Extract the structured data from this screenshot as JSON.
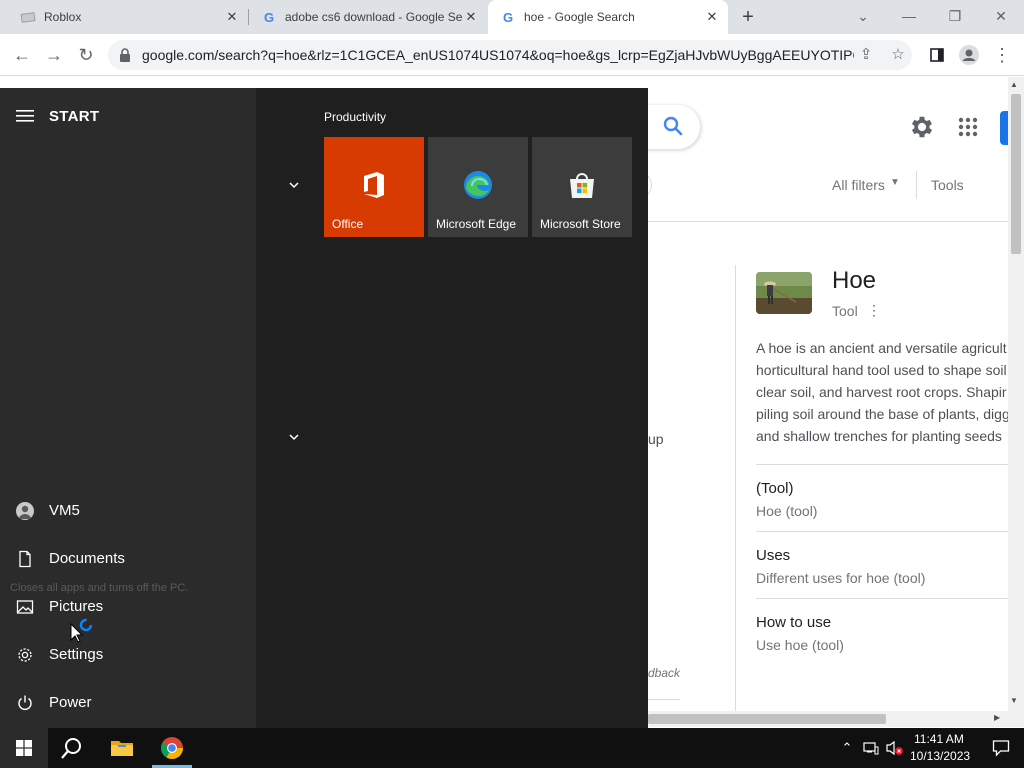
{
  "browser": {
    "tabs": [
      {
        "title": "Roblox",
        "favicon": "roblox-icon",
        "active": false
      },
      {
        "title": "adobe cs6 download - Google Se",
        "favicon": "google-g-icon",
        "active": false
      },
      {
        "title": "hoe - Google Search",
        "favicon": "google-g-icon",
        "active": true
      }
    ],
    "favicon_letter": "G",
    "new_tab_glyph": "+",
    "url": "google.com/search?q=hoe&rlz=1C1GCEA_enUS1074US1074&oq=hoe&gs_lcrp=EgZjaHJvbWUyBggAEEUYOTIPC..."
  },
  "google": {
    "all_filters_label": "All filters",
    "tools_label": "Tools",
    "partial_text_up": "up",
    "partial_text_feedback": "dback",
    "accent_color": "#1a73e8",
    "knowledge_panel": {
      "title": "Hoe",
      "subtitle": "Tool",
      "description_lines": [
        "A hoe is an ancient and versatile agricult",
        "horticultural hand tool used to shape soil",
        "clear soil, and harvest root crops. Shapir",
        "piling soil around the base of plants, digg",
        "and shallow trenches for planting seeds"
      ],
      "sections": [
        {
          "heading": "(Tool)",
          "sub": "Hoe (tool)"
        },
        {
          "heading": "Uses",
          "sub": "Different uses for hoe (tool)"
        },
        {
          "heading": "How to use",
          "sub": "Use hoe (tool)"
        }
      ]
    }
  },
  "start_menu": {
    "title": "START",
    "user": "VM5",
    "items": [
      {
        "label": "Documents",
        "icon": "document-icon"
      },
      {
        "label": "Pictures",
        "icon": "pictures-icon"
      },
      {
        "label": "Settings",
        "icon": "gear-icon"
      },
      {
        "label": "Power",
        "icon": "power-icon"
      }
    ],
    "tooltip": "Closes all apps and turns off the PC.",
    "group_label": "Productivity",
    "tiles": [
      {
        "label": "Office",
        "color": "#d83b01"
      },
      {
        "label": "Microsoft Edge",
        "color": "#3c3c3c"
      },
      {
        "label": "Microsoft Store",
        "color": "#3c3c3c"
      }
    ]
  },
  "taskbar": {
    "time": "11:41 AM",
    "date": "10/13/2023",
    "accent": "#76b9ed"
  }
}
